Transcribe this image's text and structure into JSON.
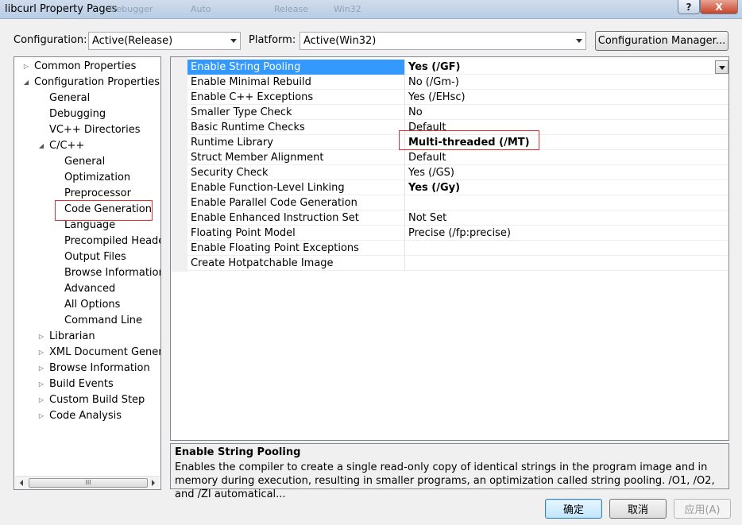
{
  "window": {
    "title": "libcurl Property Pages",
    "ghost_toolbar": [
      "Debugger",
      "Auto",
      "Release",
      "Win32"
    ],
    "help_label": "?",
    "close_label": "X"
  },
  "config": {
    "configuration_label": "Configuration:",
    "configuration_value": "Active(Release)",
    "platform_label": "Platform:",
    "platform_value": "Active(Win32)",
    "manager_button": "Configuration Manager..."
  },
  "tree": {
    "items": [
      {
        "label": "Common Properties",
        "expander": "collapsed"
      },
      {
        "label": "Configuration Properties",
        "expander": "expanded"
      },
      {
        "label": "General",
        "expander": "none"
      },
      {
        "label": "Debugging",
        "expander": "none"
      },
      {
        "label": "VC++ Directories",
        "expander": "none"
      },
      {
        "label": "C/C++",
        "expander": "expanded"
      },
      {
        "label": "General",
        "expander": "none"
      },
      {
        "label": "Optimization",
        "expander": "none"
      },
      {
        "label": "Preprocessor",
        "expander": "none"
      },
      {
        "label": "Code Generation",
        "expander": "none",
        "selected": true
      },
      {
        "label": "Language",
        "expander": "none"
      },
      {
        "label": "Precompiled Header",
        "expander": "none"
      },
      {
        "label": "Output Files",
        "expander": "none"
      },
      {
        "label": "Browse Information",
        "expander": "none"
      },
      {
        "label": "Advanced",
        "expander": "none"
      },
      {
        "label": "All Options",
        "expander": "none"
      },
      {
        "label": "Command Line",
        "expander": "none"
      },
      {
        "label": "Librarian",
        "expander": "collapsed"
      },
      {
        "label": "XML Document Generat",
        "expander": "collapsed"
      },
      {
        "label": "Browse Information",
        "expander": "collapsed"
      },
      {
        "label": "Build Events",
        "expander": "collapsed"
      },
      {
        "label": "Custom Build Step",
        "expander": "collapsed"
      },
      {
        "label": "Code Analysis",
        "expander": "collapsed"
      }
    ],
    "scroll_thumb_label": "III"
  },
  "properties": [
    {
      "name": "Enable String Pooling",
      "value": "Yes (/GF)",
      "bold": true,
      "selected": true
    },
    {
      "name": "Enable Minimal Rebuild",
      "value": "No (/Gm-)",
      "bold": false
    },
    {
      "name": "Enable C++ Exceptions",
      "value": "Yes (/EHsc)",
      "bold": false
    },
    {
      "name": "Smaller Type Check",
      "value": "No",
      "bold": false
    },
    {
      "name": "Basic Runtime Checks",
      "value": "Default",
      "bold": false
    },
    {
      "name": "Runtime Library",
      "value": "Multi-threaded (/MT)",
      "bold": true,
      "highlighted": true
    },
    {
      "name": "Struct Member Alignment",
      "value": "Default",
      "bold": false
    },
    {
      "name": "Security Check",
      "value": "Yes (/GS)",
      "bold": false
    },
    {
      "name": "Enable Function-Level Linking",
      "value": "Yes (/Gy)",
      "bold": true
    },
    {
      "name": "Enable Parallel Code Generation",
      "value": "",
      "bold": false
    },
    {
      "name": "Enable Enhanced Instruction Set",
      "value": "Not Set",
      "bold": false
    },
    {
      "name": "Floating Point Model",
      "value": "Precise (/fp:precise)",
      "bold": false
    },
    {
      "name": "Enable Floating Point Exceptions",
      "value": "",
      "bold": false
    },
    {
      "name": "Create Hotpatchable Image",
      "value": "",
      "bold": false
    }
  ],
  "description": {
    "title": "Enable String Pooling",
    "text": "Enables the compiler to create a single read-only copy of identical strings in the program image and in memory during execution, resulting in smaller programs, an optimization called string pooling. /O1, /O2, and /ZI  automatical..."
  },
  "buttons": {
    "ok": "确定",
    "cancel": "取消",
    "apply": "应用(A)"
  },
  "colors": {
    "selection": "#3399ff",
    "highlight_box": "#e2312f"
  }
}
